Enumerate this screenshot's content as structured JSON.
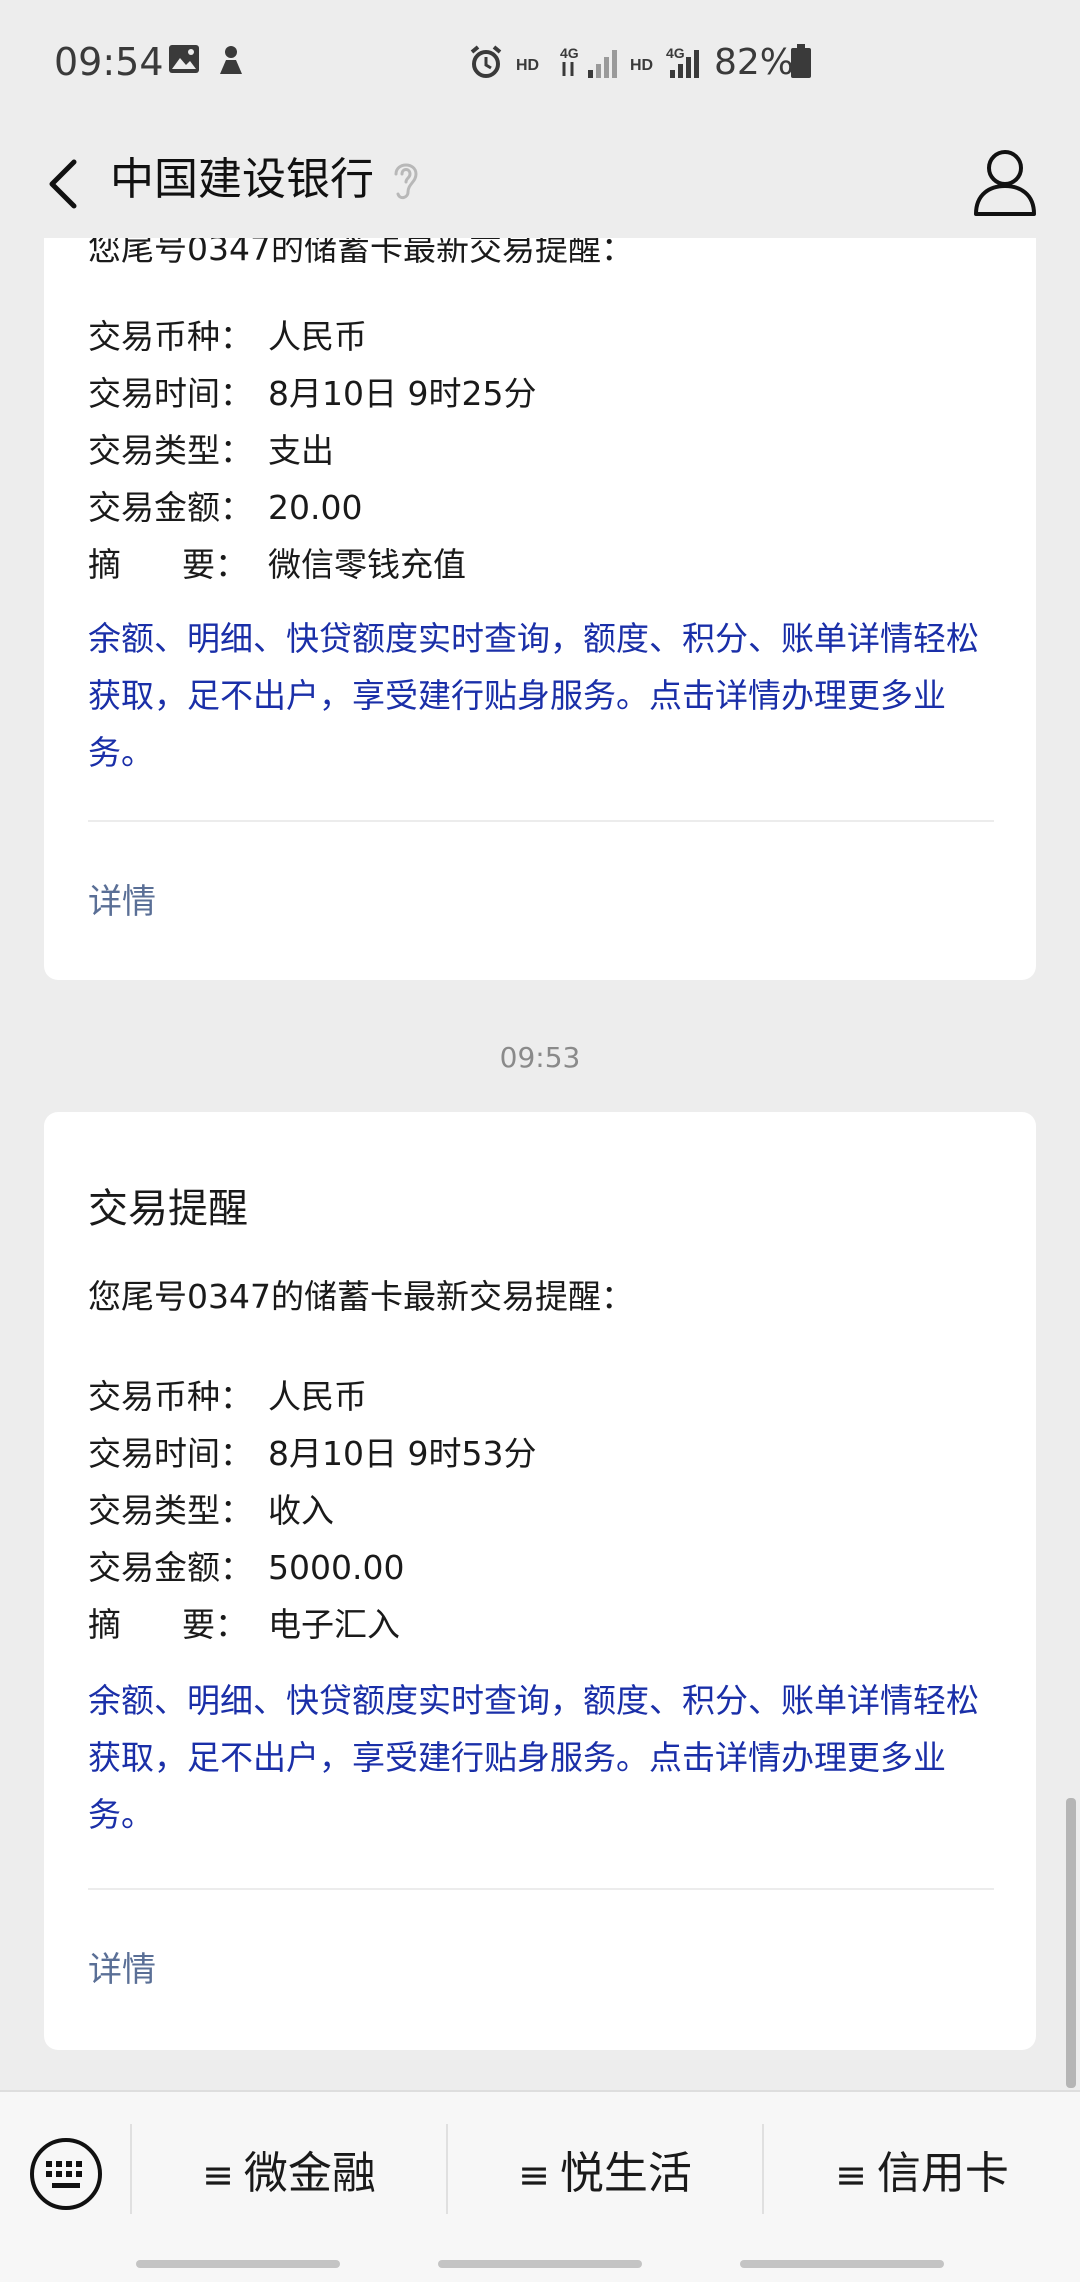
{
  "status_bar": {
    "time": "09:54",
    "battery": "82%",
    "icons": [
      "image-icon",
      "notification-icon",
      "alarm-icon",
      "hd-4g-signal-icon",
      "hd-4g-signal-icon",
      "battery-icon"
    ]
  },
  "nav": {
    "title": "中国建设银行",
    "back_icon": "chevron-left-icon",
    "ear_icon": "ear-icon",
    "profile_icon": "person-icon"
  },
  "cards": [
    {
      "partial_intro": "您尾号0347的储蓄卡最新交易提醒：",
      "fields": [
        {
          "label": "交易币种：",
          "value": "人民币"
        },
        {
          "label": "交易时间：",
          "value": "8月10日 9时25分"
        },
        {
          "label": "交易类型：",
          "value": "支出"
        },
        {
          "label": "交易金额：",
          "value": "20.00"
        },
        {
          "label_a": "摘",
          "label_b": "要：",
          "value": "微信零钱充值"
        }
      ],
      "promo": "余额、明细、快贷额度实时查询，额度、积分、账单详情轻松获取，足不出户，享受建行贴身服务。点击详情办理更多业务。",
      "details_label": "详情"
    },
    {
      "timestamp": "09:53",
      "title": "交易提醒",
      "intro": "您尾号0347的储蓄卡最新交易提醒：",
      "fields": [
        {
          "label": "交易币种：",
          "value": "人民币"
        },
        {
          "label": "交易时间：",
          "value": "8月10日 9时53分"
        },
        {
          "label": "交易类型：",
          "value": "收入"
        },
        {
          "label": "交易金额：",
          "value": "5000.00"
        },
        {
          "label_a": "摘",
          "label_b": "要：",
          "value": "电子汇入"
        }
      ],
      "promo": "余额、明细、快贷额度实时查询，额度、积分、账单详情轻松获取，足不出户，享受建行贴身服务。点击详情办理更多业务。",
      "details_label": "详情"
    }
  ],
  "bottom_menu": {
    "keyboard_icon": "keyboard-icon",
    "menu_icon": "≡",
    "items": [
      "微金融",
      "悦生活",
      "信用卡"
    ]
  }
}
